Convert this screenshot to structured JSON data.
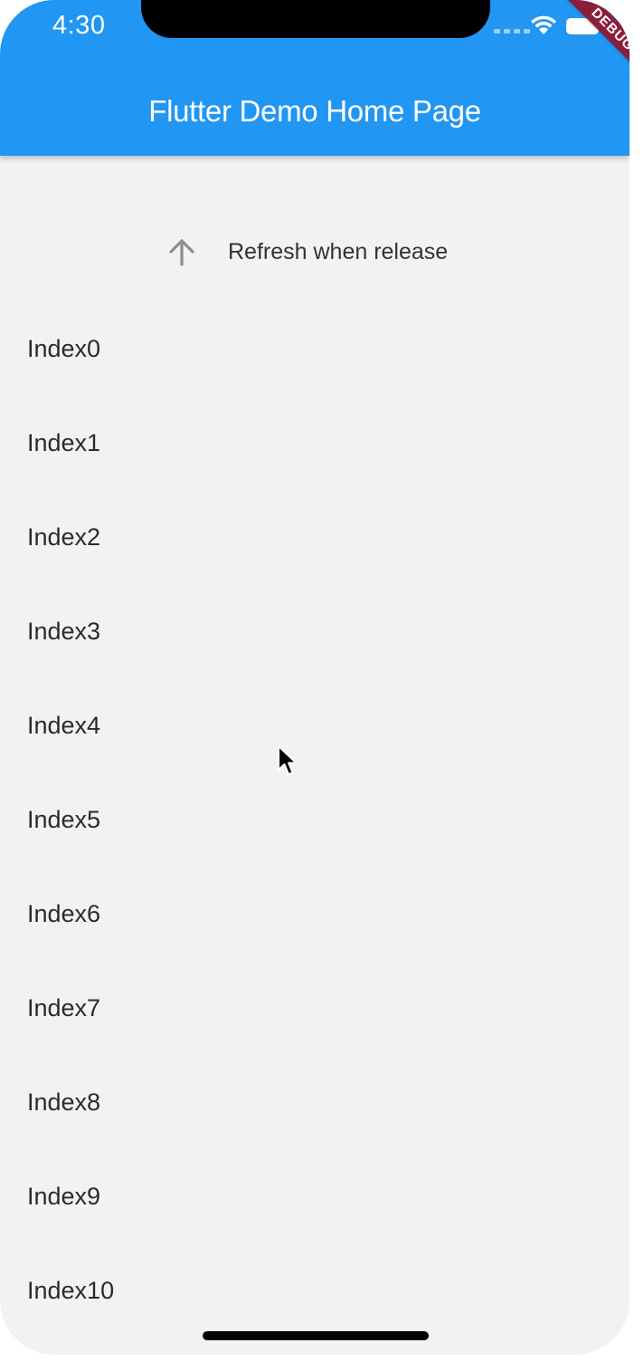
{
  "status_bar": {
    "time": "4:30",
    "signal_icon": "cellular-signal-icon",
    "wifi_icon": "wifi-icon",
    "battery_icon": "battery-icon"
  },
  "app_bar": {
    "title": "Flutter Demo Home Page",
    "background_color": "#2196f3"
  },
  "debug_banner": {
    "label": "DEBUG",
    "color": "#8b1e3a"
  },
  "refresh_header": {
    "icon": "arrow-up-icon",
    "text": "Refresh when release"
  },
  "list": {
    "items": [
      "Index0",
      "Index1",
      "Index2",
      "Index3",
      "Index4",
      "Index5",
      "Index6",
      "Index7",
      "Index8",
      "Index9",
      "Index10"
    ]
  }
}
